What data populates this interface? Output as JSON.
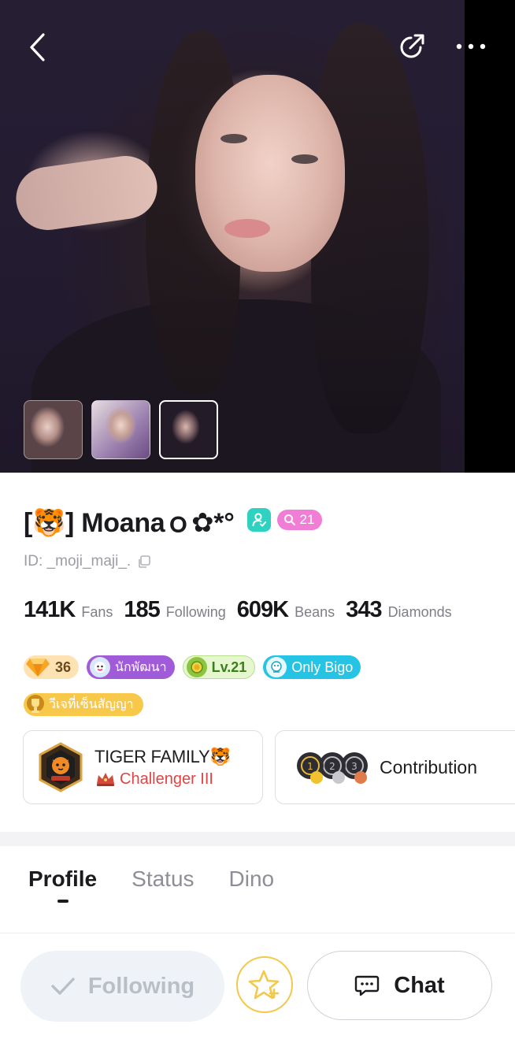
{
  "cover": {
    "photo_count": 3,
    "active_index": 2
  },
  "profile": {
    "name": "[🐯] Moanaｏ✿*°",
    "level_badge": "21",
    "id_label": "ID: _moji_maji_."
  },
  "stats": [
    {
      "value": "141K",
      "label": "Fans"
    },
    {
      "value": "185",
      "label": "Following"
    },
    {
      "value": "609K",
      "label": "Beans"
    },
    {
      "value": "343",
      "label": "Diamonds"
    }
  ],
  "badges": {
    "gem_level": "36",
    "developer": "นักพัฒนา",
    "user_level": "Lv.21",
    "only_bigo": "Only Bigo",
    "signed": "วีเจที่เซ็นสัญญา"
  },
  "family": {
    "name": "TIGER FAMILY🐯",
    "rank": "Challenger III"
  },
  "contribution": {
    "label": "Contribution"
  },
  "tabs": [
    "Profile",
    "Status",
    "Dino"
  ],
  "actions": {
    "following_label": "Following",
    "chat_label": "Chat"
  },
  "colors": {
    "accent_pink": "#f07ed6",
    "verify_teal": "#2fd1c0",
    "rank_red": "#e04545",
    "star_gold": "#f2c94c"
  }
}
